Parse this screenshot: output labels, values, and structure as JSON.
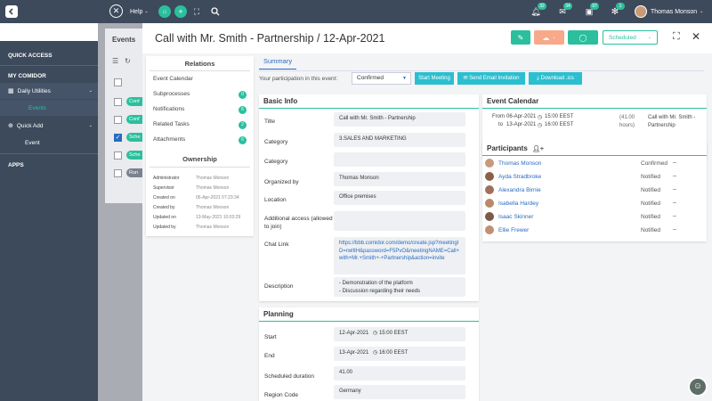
{
  "topbar": {
    "help": "Help",
    "user": "Thomas Monson",
    "badges": {
      "notifications": "32",
      "messages": "34",
      "calendar": "97",
      "settings": "1"
    }
  },
  "sidebar": {
    "quick_access": "QUICK ACCESS",
    "my_comidor": "MY COMIDOR",
    "daily_utilities": "Daily Utilities",
    "events": "Events",
    "quick_add": "Quick Add",
    "event": "Event",
    "apps": "APPS"
  },
  "background": {
    "title": "Events",
    "statuses": [
      "Conf",
      "Conf",
      "Sche",
      "Sche",
      "Run"
    ]
  },
  "modal": {
    "title": "Call with Mr. Smith - Partnership / 12-Apr-2021",
    "status": "Scheduled",
    "tab": "Summary",
    "participation_label": "Your participation in this event:",
    "participation_value": "Confirmed",
    "btn_start": "Start Meeting",
    "btn_email": "Send Email Invitation",
    "btn_download": "Download .ics"
  },
  "relations": {
    "title": "Relations",
    "items": [
      {
        "label": "Event Calendar",
        "count": ""
      },
      {
        "label": "Subprocesses",
        "count": "0"
      },
      {
        "label": "Notifications",
        "count": "6"
      },
      {
        "label": "Related Tasks",
        "count": "2"
      },
      {
        "label": "Attachments",
        "count": "6"
      }
    ]
  },
  "ownership": {
    "title": "Ownership",
    "rows": [
      {
        "k": "Administrator",
        "v": "Thomas Monson"
      },
      {
        "k": "Supervisor",
        "v": "Thomas Monson"
      },
      {
        "k": "Created on",
        "v": "06-Apr-2021 07:23:34"
      },
      {
        "k": "Created by",
        "v": "Thomas Monson"
      },
      {
        "k": "Updated on",
        "v": "13-May-2021 10:03:29"
      },
      {
        "k": "Updated by",
        "v": "Thomas Monson"
      }
    ]
  },
  "basic_info": {
    "title": "Basic Info",
    "fields": [
      {
        "label": "Title",
        "value": "Call with Mr. Smith - Partnership"
      },
      {
        "label": "Category",
        "value": "3.SALES AND MARKETING"
      },
      {
        "label": "Category",
        "value": ""
      },
      {
        "label": "Organized by",
        "value": "Thomas Monson"
      },
      {
        "label": "Location",
        "value": "Office premises"
      },
      {
        "label": "Additional access (allowed to join)",
        "value": ""
      },
      {
        "label": "Chat Link",
        "value": "https://bbb.comidor.com/demo/create.jsp?meetingID=rwlItH&password=F5PvO&meetingNAME=Call+with+Mr.+Smith+-+Partnership&action=invite"
      },
      {
        "label": "Description",
        "value": "- Demonstration of the platform\n- Discussion regarding their needs"
      }
    ]
  },
  "planning": {
    "title": "Planning",
    "fields": [
      {
        "label": "Start",
        "value": "12-Apr-2021",
        "time": "15:00 EEST"
      },
      {
        "label": "End",
        "value": "13-Apr-2021",
        "time": "16:00 EEST"
      },
      {
        "label": "Scheduled duration",
        "value": "41.00",
        "time": ""
      },
      {
        "label": "Region Code",
        "value": "Germany",
        "time": ""
      }
    ]
  },
  "event_calendar": {
    "title": "Event Calendar",
    "from_label": "From",
    "from": "06-Apr-2021",
    "from_time": "15:00 EEST",
    "to_label": "to",
    "to": "13-Apr-2021",
    "to_time": "16:00 EEST",
    "duration": "(41.00 hours)",
    "name": "Call with Mr. Smith - Partnership"
  },
  "participants": {
    "title": "Participants",
    "list": [
      {
        "name": "Thomas Monson",
        "status": "Confirmed"
      },
      {
        "name": "Ayda Stradbroke",
        "status": "Notified"
      },
      {
        "name": "Alexandra Birnie",
        "status": "Notified"
      },
      {
        "name": "Isabella Hardey",
        "status": "Notified"
      },
      {
        "name": "Isaac Skinner",
        "status": "Notified"
      },
      {
        "name": "Ellie Frewer",
        "status": "Notified"
      }
    ]
  }
}
